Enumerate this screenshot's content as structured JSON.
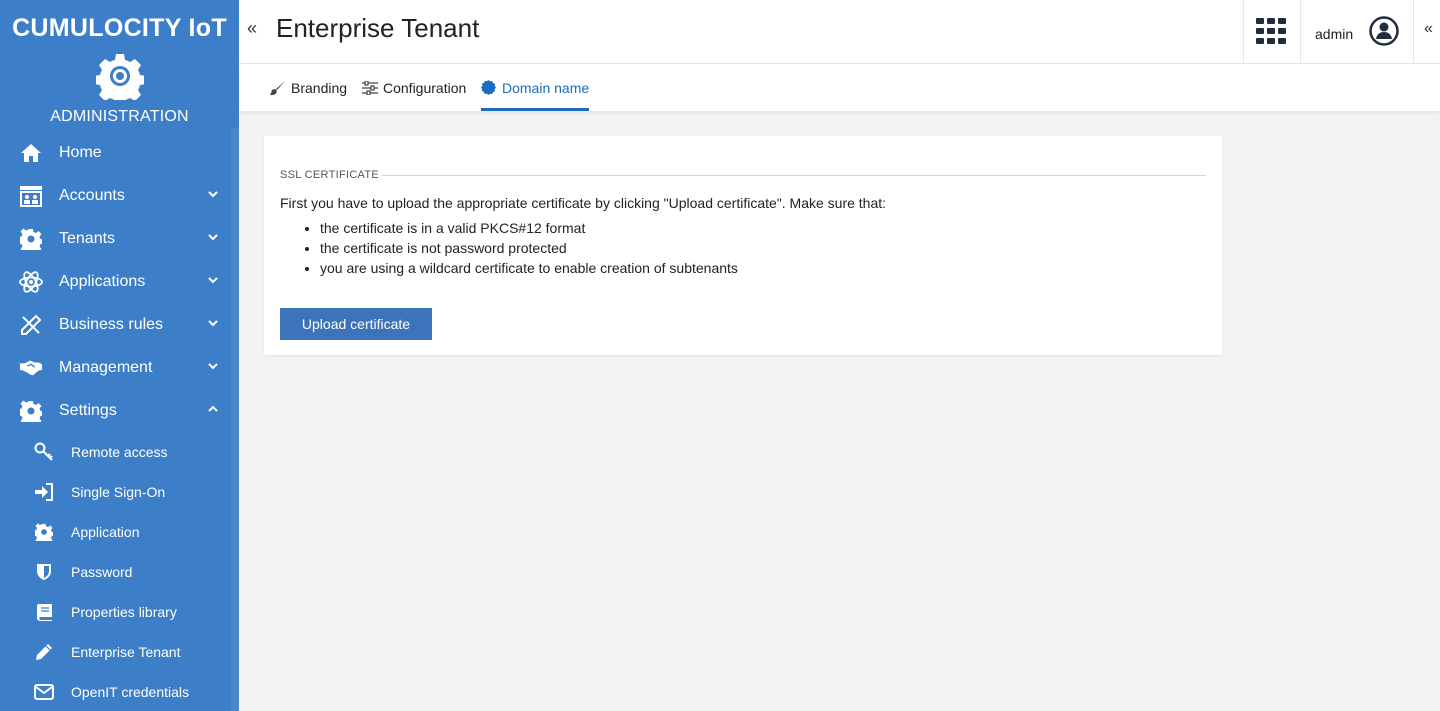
{
  "sidebar": {
    "logo_text": "CUMULOCITY IoT",
    "app_name": "ADMINISTRATION",
    "items": [
      {
        "label": "Home",
        "icon": "home-icon"
      },
      {
        "label": "Accounts",
        "icon": "accounts-icon"
      },
      {
        "label": "Tenants",
        "icon": "gear-icon"
      },
      {
        "label": "Applications",
        "icon": "atom-icon"
      },
      {
        "label": "Business rules",
        "icon": "pencil-ruler-icon"
      },
      {
        "label": "Management",
        "icon": "handshake-icon"
      },
      {
        "label": "Settings",
        "icon": "gear-icon"
      }
    ],
    "settings_items": [
      {
        "label": "Remote access",
        "icon": "key-icon"
      },
      {
        "label": "Single Sign-On",
        "icon": "sign-in-icon"
      },
      {
        "label": "Application",
        "icon": "gear-icon"
      },
      {
        "label": "Password",
        "icon": "shield-icon"
      },
      {
        "label": "Properties library",
        "icon": "book-icon"
      },
      {
        "label": "Enterprise Tenant",
        "icon": "pencil-icon"
      },
      {
        "label": "OpenIT credentials",
        "icon": "envelope-icon"
      }
    ]
  },
  "header": {
    "title": "Enterprise Tenant",
    "user": "admin"
  },
  "tabs": [
    {
      "label": "Branding",
      "icon": "brush-icon",
      "active": false
    },
    {
      "label": "Configuration",
      "icon": "sliders-icon",
      "active": false
    },
    {
      "label": "Domain name",
      "icon": "badge-icon",
      "active": true
    }
  ],
  "card": {
    "legend": "SSL CERTIFICATE",
    "intro": "First you have to upload the appropriate certificate by clicking \"Upload certificate\". Make sure that:",
    "requirements": [
      "the certificate is in a valid PKCS#12 format",
      "the certificate is not password protected",
      "you are using a wildcard certificate to enable creation of subtenants"
    ],
    "upload_button": "Upload certificate"
  },
  "colors": {
    "sidebar_bg": "#3c7ec7",
    "accent": "#1c6bbf",
    "button_bg": "#3c74bb",
    "page_bg": "#f2f3f4"
  }
}
